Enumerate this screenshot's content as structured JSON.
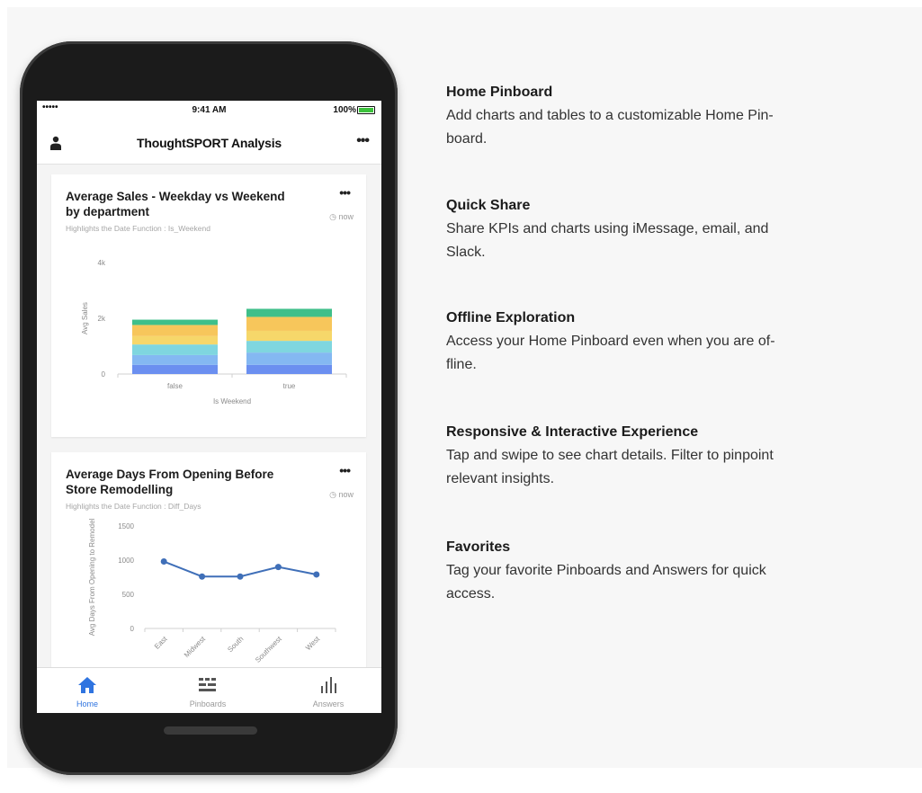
{
  "colors": {
    "accent": "#2f74e0",
    "line": "#3f6fb8",
    "bar_segments": [
      "#6b8ff0",
      "#84b8f2",
      "#7fd6df",
      "#f6d76a",
      "#f7c65b",
      "#3fbf8a"
    ]
  },
  "status_bar": {
    "signal": "•••••",
    "time": "9:41 AM",
    "battery": "100%",
    "battery_level": 1.0
  },
  "nav": {
    "title": "ThoughtSPORT Analysis",
    "left_icon": "user-icon",
    "right_icon": "more-icon"
  },
  "cards": [
    {
      "title": "Average Sales - Weekday vs Weekend by department",
      "subtitle": "Highlights the Date Function : Is_Weekend",
      "time": "now",
      "more": "•••"
    },
    {
      "title": "Average Days From Opening Before Store Remodelling",
      "subtitle": "Highlights the Date Function : Diff_Days",
      "time": "now",
      "more": "•••"
    }
  ],
  "chart_data": [
    {
      "type": "bar",
      "stacked": true,
      "categories": [
        "false",
        "true"
      ],
      "xlabel": "Is Weekend",
      "ylabel": "Avg Sales",
      "ylim": [
        0,
        4000
      ],
      "yticks": [
        "0",
        "2k",
        "4k"
      ],
      "series": [
        {
          "values": [
            330,
            330
          ]
        },
        {
          "values": [
            350,
            440
          ]
        },
        {
          "values": [
            380,
            420
          ]
        },
        {
          "values": [
            300,
            360
          ]
        },
        {
          "values": [
            400,
            500
          ]
        },
        {
          "values": [
            190,
            290
          ]
        }
      ]
    },
    {
      "type": "line",
      "categories": [
        "East",
        "Midwest",
        "South",
        "Southwest",
        "West"
      ],
      "ylabel": "Avg Days From Opening to Remodel",
      "ylim": [
        0,
        1500
      ],
      "yticks": [
        "0",
        "500",
        "1000",
        "1500"
      ],
      "values": [
        980,
        760,
        760,
        900,
        790
      ]
    }
  ],
  "tabs": [
    {
      "label": "Home",
      "icon": "home-icon",
      "active": true
    },
    {
      "label": "Pinboards",
      "icon": "pinboards-icon",
      "active": false
    },
    {
      "label": "Answers",
      "icon": "answers-icon",
      "active": false
    }
  ],
  "features": [
    {
      "title": "Home Pinboard",
      "text": [
        "Add charts and tables to a customizable Home Pin-",
        "board."
      ]
    },
    {
      "title": "Quick Share",
      "text": [
        "Share KPIs and charts using iMessage, email, and",
        "Slack."
      ]
    },
    {
      "title": "Offline Exploration",
      "text": [
        "Access your Home Pinboard even when you are of-",
        "fline."
      ]
    },
    {
      "title": "Responsive & Interactive Experience",
      "text": [
        "Tap and swipe to see chart details. Filter to pinpoint",
        "relevant insights."
      ]
    },
    {
      "title": "Favorites",
      "text": [
        "Tag your favorite Pinboards and Answers for quick",
        "access."
      ]
    }
  ]
}
